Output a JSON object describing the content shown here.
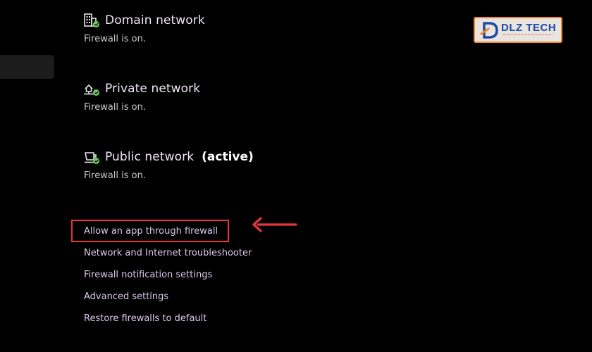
{
  "networks": {
    "domain": {
      "title": "Domain network",
      "status": "Firewall is on.",
      "icon": "domain-network-icon"
    },
    "private": {
      "title": "Private network",
      "status": "Firewall is on.",
      "icon": "private-network-icon"
    },
    "public": {
      "title": "Public network",
      "active_label": "(active)",
      "status": "Firewall is on.",
      "icon": "public-network-icon"
    }
  },
  "links": [
    {
      "label": "Allow an app through firewall",
      "highlighted": true
    },
    {
      "label": "Network and Internet troubleshooter"
    },
    {
      "label": "Firewall notification settings"
    },
    {
      "label": "Advanced settings"
    },
    {
      "label": "Restore firewalls to default"
    }
  ],
  "watermark": {
    "brand": "DLZ TECH"
  },
  "colors": {
    "background": "#000000",
    "title_text": "#f0e6f7",
    "link_text": "#dcc9ea",
    "status_ok": "#6ccb5f",
    "annotation_red": "#e8353b",
    "logo_orange": "#f08a2c",
    "logo_blue": "#1e4aa5"
  }
}
